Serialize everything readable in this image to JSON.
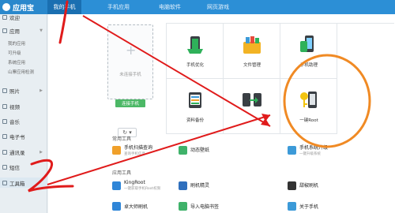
{
  "app": {
    "title": "应用宝"
  },
  "tabs": [
    {
      "label": "我的手机",
      "active": true
    },
    {
      "label": "手机应用",
      "active": false
    },
    {
      "label": "电脑软件",
      "active": false
    },
    {
      "label": "网页游戏",
      "active": false
    }
  ],
  "sidebar": {
    "items": [
      {
        "label": "欢迎",
        "icon": "home-icon"
      },
      {
        "label": "应用",
        "icon": "apps-icon",
        "sub": [
          "我的应用",
          "可升级",
          "系统应用",
          "山寨应用检测"
        ]
      },
      {
        "label": "照片",
        "icon": "photo-icon"
      },
      {
        "label": "视频",
        "icon": "video-icon"
      },
      {
        "label": "音乐",
        "icon": "music-icon"
      },
      {
        "label": "电子书",
        "icon": "book-icon"
      },
      {
        "label": "通讯录",
        "icon": "contacts-icon"
      },
      {
        "label": "短信",
        "icon": "sms-icon"
      },
      {
        "label": "工具箱",
        "icon": "toolbox-icon",
        "active": true
      }
    ]
  },
  "phone": {
    "not_connected": "未连接手机",
    "connect_label": "连接手机",
    "refresh_label": "↻ ▾"
  },
  "grid_tiles": [
    {
      "label": "手机优化",
      "icon": "phone-optimize-icon"
    },
    {
      "label": "文件管理",
      "icon": "file-manager-icon"
    },
    {
      "label": "手机助理",
      "icon": "phone-assistant-icon"
    },
    {
      "label": "资料备份",
      "icon": "backup-icon"
    },
    {
      "label": "",
      "icon": "transfer-icon"
    },
    {
      "label": "一键Root",
      "icon": "root-key-icon"
    }
  ],
  "sections": {
    "common_tools": "常用工具",
    "app_tools": "应用工具"
  },
  "tools": [
    {
      "title": "手机扫描查询",
      "desc": "查询手机信息",
      "icon": "scan-icon",
      "color": "#f0a02a"
    },
    {
      "title": "动态壁纸",
      "desc": "",
      "icon": "wallpaper-icon",
      "color": "#3fb26a"
    },
    {
      "title": "手机系统升级",
      "desc": "一键升级系统",
      "icon": "system-upgrade-icon",
      "color": "#3c9ad8"
    },
    {
      "title": "KingRoot",
      "desc": "一键获取手机Root权限",
      "icon": "kingroot-icon",
      "color": "#2f86d8"
    },
    {
      "title": "刷机精灵",
      "desc": "",
      "icon": "flash-icon",
      "color": "#2f6fbd"
    },
    {
      "title": "甜椒刷机",
      "desc": "",
      "icon": "pepper-flash-icon",
      "color": "#333333"
    },
    {
      "title": "卓大师刷机",
      "desc": "",
      "icon": "zhuo-flash-icon",
      "color": "#2f86d8"
    },
    {
      "title": "导入电脑书签",
      "desc": "",
      "icon": "bookmark-icon",
      "color": "#3fb26a"
    },
    {
      "title": "关于手机",
      "desc": "",
      "icon": "about-phone-icon",
      "color": "#3c9ad8"
    }
  ],
  "annotations": {
    "number_1": "1",
    "number_2": "2",
    "arrow_color": "#e01b1b",
    "circle_color": "#f08a24"
  }
}
